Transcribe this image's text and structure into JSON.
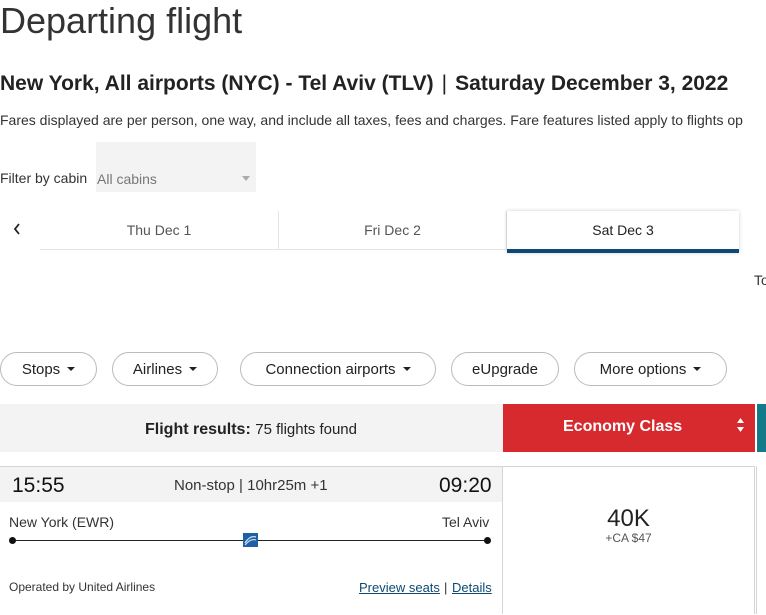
{
  "page": {
    "title": "Departing flight",
    "route": "New York, All airports (NYC) - Tel Aviv (TLV)",
    "separator": "|",
    "date": "Saturday December 3, 2022",
    "fare_note": "Fares displayed are per person, one way, and include all taxes, fees and charges. Fare features listed apply to flights op"
  },
  "filter": {
    "label": "Filter by cabin",
    "value": "All cabins"
  },
  "date_tabs": {
    "prev_icon": "chevron-left-icon",
    "tabs": [
      {
        "label": "Thu Dec 1"
      },
      {
        "label": "Fri Dec 2"
      },
      {
        "label": "Sat Dec 3",
        "active": true
      }
    ],
    "partial_label": "To"
  },
  "filters_row": {
    "stops": "Stops",
    "airlines": "Airlines",
    "connection_airports": "Connection airports",
    "eupgrade": "eUpgrade",
    "more_options": "More options"
  },
  "results": {
    "label": "Flight results:",
    "count": "75 flights found",
    "cabin_header": "Economy Class",
    "colors": {
      "cabin_header": "#d72a2f",
      "accent": "#0c4a73",
      "teal": "#117b8a"
    }
  },
  "flight": {
    "departure_time": "15:55",
    "stops_info": "Non-stop | 10hr25m +1",
    "arrival_time": "09:20",
    "origin": "New York (EWR)",
    "destination": "Tel Aviv",
    "operated_by": "Operated by United Airlines",
    "preview_seats": "Preview seats",
    "link_separator": "|",
    "details": "Details",
    "fare_miles": "40K",
    "fare_cash": "+CA $47"
  }
}
